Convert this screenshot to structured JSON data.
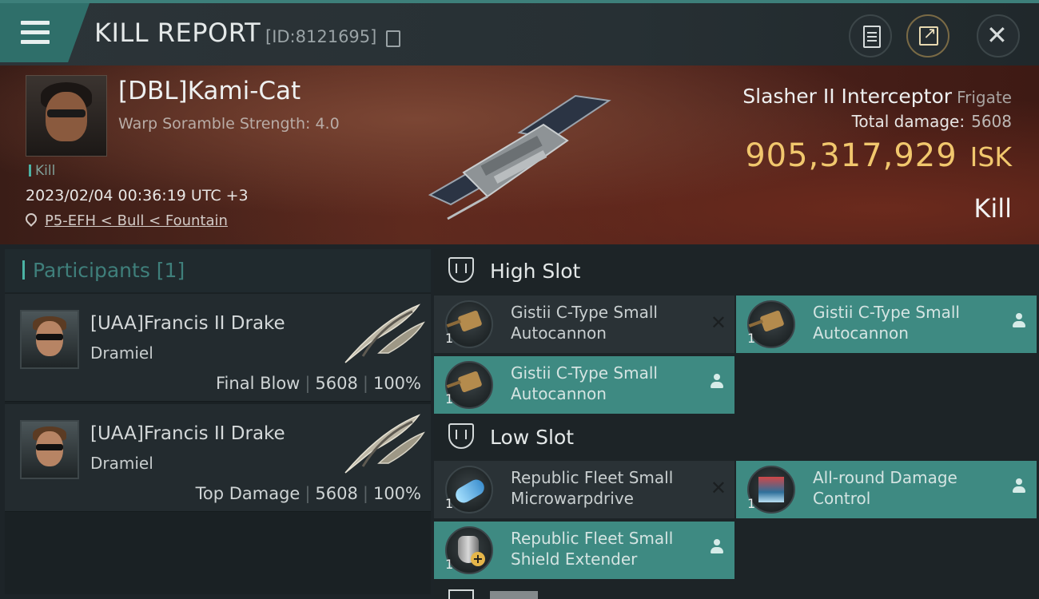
{
  "header": {
    "title": "KILL REPORT",
    "report_id": "[ID:8121695]",
    "icons": [
      "menu-icon",
      "copy-icon",
      "notes-icon",
      "share-icon",
      "close-icon"
    ]
  },
  "victim": {
    "name": "[DBL]Kami-Cat",
    "stat": "Warp Soramble Strength: 4.0",
    "tag": "Kill",
    "timestamp": "2023/02/04 00:36:19 UTC +3",
    "location": "P5-EFH < Bull < Fountain",
    "ship_name": "Slasher II Interceptor",
    "ship_class": "Frigate",
    "total_damage_label": "Total damage:",
    "total_damage": "5608",
    "isk_value": "905,317,929",
    "isk_unit": "ISK",
    "result": "Kill"
  },
  "participants": {
    "title": "Participants [1]",
    "cards": [
      {
        "name": "[UAA]Francis II Drake",
        "ship": "Dramiel",
        "role": "Final Blow",
        "damage": "5608",
        "percent": "100%"
      },
      {
        "name": "[UAA]Francis II Drake",
        "ship": "Dramiel",
        "role": "Top Damage",
        "damage": "5608",
        "percent": "100%"
      }
    ]
  },
  "fitting": {
    "high_slot": {
      "title": "High Slot",
      "modules": [
        {
          "name": "Gistii C-Type Small Autocannon",
          "qty": "1",
          "state": "destroyed"
        },
        {
          "name": "Gistii C-Type Small Autocannon",
          "qty": "1",
          "state": "dropped"
        },
        {
          "name": "Gistii C-Type Small Autocannon",
          "qty": "1",
          "state": "dropped"
        }
      ]
    },
    "low_slot": {
      "title": "Low Slot",
      "modules": [
        {
          "name": "Republic Fleet Small Microwarpdrive",
          "qty": "1",
          "state": "destroyed"
        },
        {
          "name": "All-round Damage Control",
          "qty": "1",
          "state": "dropped"
        },
        {
          "name": "Republic Fleet Small Shield Extender",
          "qty": "1",
          "state": "dropped"
        }
      ]
    }
  },
  "colors": {
    "accent": "#3e8a82",
    "isk": "#f1c76d",
    "header_bg": "#2c3438"
  }
}
